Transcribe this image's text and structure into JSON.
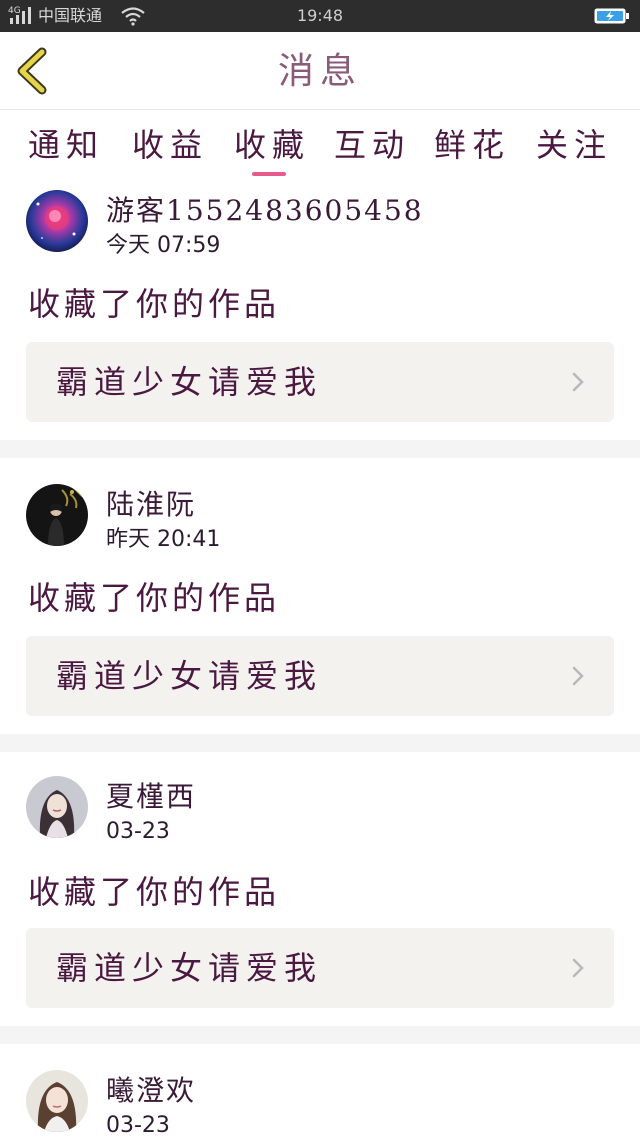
{
  "status_bar": {
    "network": "4G",
    "carrier": "中国联通",
    "time": "19:48",
    "icons": [
      "signal-icon",
      "wifi-icon",
      "battery-charging-icon"
    ]
  },
  "header": {
    "title": "消息",
    "back_icon": "chevron-left-icon"
  },
  "tabs": [
    {
      "label": "通知",
      "active": false
    },
    {
      "label": "收益",
      "active": false
    },
    {
      "label": "收藏",
      "active": true
    },
    {
      "label": "互动",
      "active": false
    },
    {
      "label": "鲜花",
      "active": false
    },
    {
      "label": "关注",
      "active": false
    }
  ],
  "messages": [
    {
      "username": "游客1552483605458",
      "time": "今天 07:59",
      "action": "收藏了你的作品",
      "work_title": "霸道少女请爱我",
      "avatar": "galaxy-rose-avatar"
    },
    {
      "username": "陆淮阮",
      "time": "昨天 20:41",
      "action": "收藏了你的作品",
      "work_title": "霸道少女请爱我",
      "avatar": "dark-portrait-avatar"
    },
    {
      "username": "夏槿西",
      "time": "03-23",
      "action": "收藏了你的作品",
      "work_title": "霸道少女请爱我",
      "avatar": "girl-portrait-avatar"
    },
    {
      "username": "曦澄欢",
      "time": "03-23",
      "action": "",
      "work_title": "",
      "avatar": "woman-portrait-avatar"
    }
  ],
  "colors": {
    "accent": "#e85a8a",
    "tab_text": "#4a1840",
    "work_box_bg": "#f3f2ee",
    "separator": "#f4f4f4",
    "status_bar_bg": "#2d2d2d"
  }
}
